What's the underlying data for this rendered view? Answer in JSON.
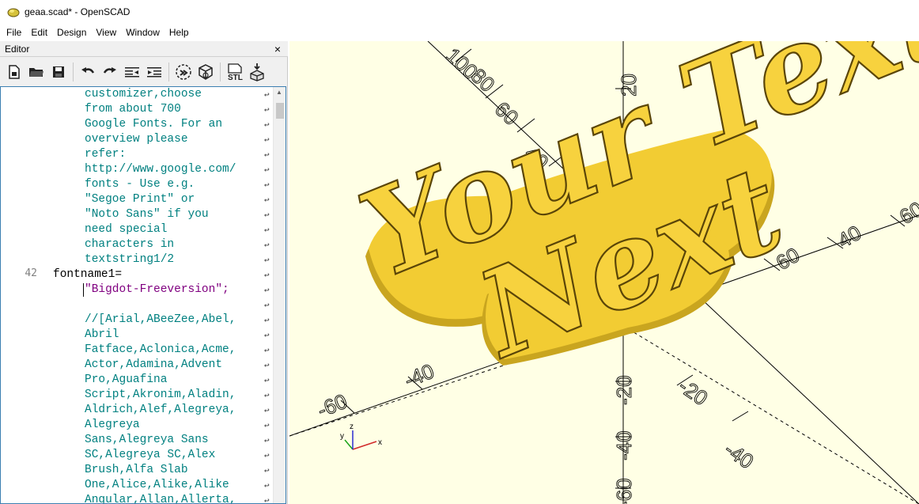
{
  "window": {
    "title": "geaa.scad* - OpenSCAD"
  },
  "menu": {
    "items": [
      "File",
      "Edit",
      "Design",
      "View",
      "Window",
      "Help"
    ]
  },
  "editor": {
    "header_label": "Editor",
    "close_glyph": "×",
    "toolbar": [
      "new-file",
      "open-file",
      "save-file",
      "undo",
      "redo",
      "unindent",
      "indent",
      "preview",
      "render",
      "export-stl",
      "send-to-3d-print"
    ],
    "line_number_42": "42",
    "code_lines": [
      {
        "text": "customizer,choose",
        "indent": 1,
        "color": "#008080"
      },
      {
        "text": "from about 700",
        "indent": 1,
        "color": "#008080"
      },
      {
        "text": "Google Fonts. For an",
        "indent": 1,
        "color": "#008080"
      },
      {
        "text": "overview please",
        "indent": 1,
        "color": "#008080"
      },
      {
        "text": "refer:",
        "indent": 1,
        "color": "#008080"
      },
      {
        "text": "http://www.google.com/",
        "indent": 1,
        "color": "#008080"
      },
      {
        "text": "fonts - Use e.g.",
        "indent": 1,
        "color": "#008080"
      },
      {
        "text": "\"Segoe Print\" or",
        "indent": 1,
        "color": "#008080"
      },
      {
        "text": "\"Noto Sans\" if you",
        "indent": 1,
        "color": "#008080"
      },
      {
        "text": "need special",
        "indent": 1,
        "color": "#008080"
      },
      {
        "text": "characters in",
        "indent": 1,
        "color": "#008080"
      },
      {
        "text": "textstring1/2",
        "indent": 1,
        "color": "#008080"
      },
      {
        "text": "fontname1=",
        "indent": 0,
        "color": "#000000"
      },
      {
        "text": "\"Bigdot-Freeversion\";",
        "indent": 1,
        "color": "#800080"
      },
      {
        "text": "",
        "indent": 1,
        "color": "#008080"
      },
      {
        "text": "//[Arial,ABeeZee,Abel,",
        "indent": 1,
        "color": "#008080"
      },
      {
        "text": "Abril",
        "indent": 1,
        "color": "#008080"
      },
      {
        "text": "Fatface,Aclonica,Acme,",
        "indent": 1,
        "color": "#008080"
      },
      {
        "text": "Actor,Adamina,Advent",
        "indent": 1,
        "color": "#008080"
      },
      {
        "text": "Pro,Aguafina",
        "indent": 1,
        "color": "#008080"
      },
      {
        "text": "Script,Akronim,Aladin,",
        "indent": 1,
        "color": "#008080"
      },
      {
        "text": "Aldrich,Alef,Alegreya,",
        "indent": 1,
        "color": "#008080"
      },
      {
        "text": "Alegreya",
        "indent": 1,
        "color": "#008080"
      },
      {
        "text": "Sans,Alegreya Sans",
        "indent": 1,
        "color": "#008080"
      },
      {
        "text": "SC,Alegreya SC,Alex",
        "indent": 1,
        "color": "#008080"
      },
      {
        "text": "Brush,Alfa Slab",
        "indent": 1,
        "color": "#008080"
      },
      {
        "text": "One,Alice,Alike,Alike",
        "indent": 1,
        "color": "#008080"
      },
      {
        "text": "Angular,Allan,Allerta,",
        "indent": 1,
        "color": "#008080"
      }
    ],
    "wrap_glyph": "↩"
  },
  "viewport": {
    "background": "#ffffe5",
    "model_color": "#f7d23e",
    "model_text_line1": "Your Text",
    "model_text_line2": "Next",
    "axis_labels": [
      "100",
      "80",
      "60",
      "40",
      "20",
      "60",
      "40",
      "60",
      "-40",
      "-60",
      "-20",
      "-20",
      "-40",
      "-40",
      "-60"
    ],
    "axis_indicator": {
      "x": "x",
      "y": "y",
      "z": "z"
    }
  }
}
